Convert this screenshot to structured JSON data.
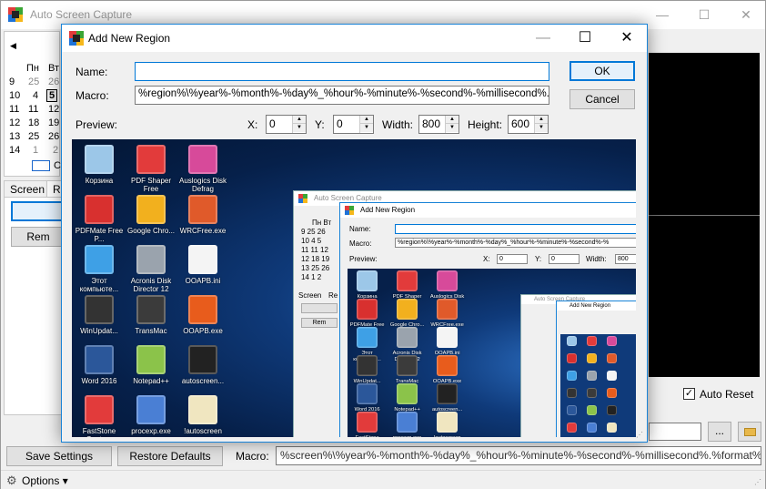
{
  "colors": {
    "accent": "#0078d7",
    "desktop": "#0f3a7a",
    "title_text_inactive": "#999999"
  },
  "main_window": {
    "title": "Auto Screen Capture",
    "icon": "auto-screen-capture-app-icon",
    "window_buttons": {
      "minimize": "—",
      "maximize": "☐",
      "close": "✕"
    },
    "calendar": {
      "nav_prev": "◀",
      "day_headers": [
        "Пн",
        "Вт"
      ],
      "weeks": [
        "9",
        "10",
        "11",
        "12",
        "13",
        "14"
      ],
      "col1": [
        "25",
        "4",
        "11",
        "18",
        "25",
        "1"
      ],
      "col2": [
        "26",
        "5",
        "12",
        "19",
        "26",
        "2"
      ],
      "selected": "5",
      "today_suffix": "C"
    },
    "tabs": [
      "Screen",
      "Re"
    ],
    "left_buttons": [
      "",
      "Rem"
    ],
    "auto_reset": {
      "label": "Auto Reset",
      "checked": true
    },
    "browse_button": "...",
    "save_settings": "Save Settings",
    "restore_defaults": "Restore Defaults",
    "macro_label": "Macro:",
    "macro_value": "%screen%\\%year%-%month%-%day%_%hour%-%minute%-%second%-%millisecond%.%format%",
    "status": {
      "options_label": "Options ▾"
    }
  },
  "dialog": {
    "title": "Add New Region",
    "window_buttons": {
      "minimize": "—",
      "maximize": "☐",
      "close": "✕"
    },
    "name_label": "Name:",
    "name_value": "",
    "macro_label": "Macro:",
    "macro_value": "%region%\\%year%-%month%-%day%_%hour%-%minute%-%second%-%millisecond%.%format%",
    "preview_label": "Preview:",
    "x_label": "X:",
    "x_value": "0",
    "y_label": "Y:",
    "y_value": "0",
    "width_label": "Width:",
    "width_value": "800",
    "height_label": "Height:",
    "height_value": "600",
    "ok_label": "OK",
    "cancel_label": "Cancel",
    "desktop_icons": [
      {
        "name": "recycle-bin-icon",
        "label": "Корзина",
        "color": "#9cc7e8"
      },
      {
        "name": "pdf-shaper-icon",
        "label": "PDF Shaper Free",
        "color": "#e23b3b"
      },
      {
        "name": "auslogics-icon",
        "label": "Auslogics Disk Defrag",
        "color": "#d74a9a"
      },
      {
        "name": "pdfmate-icon",
        "label": "PDFMate Free P...",
        "color": "#d8302f"
      },
      {
        "name": "google-chrome-icon",
        "label": "Google Chro...",
        "color": "#f2b01e"
      },
      {
        "name": "wrcfree-icon",
        "label": "WRCFree.exe",
        "color": "#e05a2a"
      },
      {
        "name": "this-pc-icon",
        "label": "Этот компьюте...",
        "color": "#3ea0e6"
      },
      {
        "name": "acronis-icon",
        "label": "Acronis Disk Director 12",
        "color": "#9aa3ad"
      },
      {
        "name": "ooapb-ini-icon",
        "label": "OOAPB.ini",
        "color": "#f4f4f4"
      },
      {
        "name": "winupdate-icon",
        "label": "WinUpdat...",
        "color": "#333333"
      },
      {
        "name": "transmac-icon",
        "label": "TransMac",
        "color": "#3b3b3b"
      },
      {
        "name": "ooapb-exe-icon",
        "label": "OOAPB.exe",
        "color": "#e85c1c"
      },
      {
        "name": "word-icon",
        "label": "Word 2016",
        "color": "#2b579a"
      },
      {
        "name": "notepad-icon",
        "label": "Notepad++",
        "color": "#8bc34a"
      },
      {
        "name": "autoscreen-icon",
        "label": "autoscreen...",
        "color": "#222222"
      },
      {
        "name": "faststone-icon",
        "label": "FastStone Capture",
        "color": "#e23b3b"
      },
      {
        "name": "procexp-icon",
        "label": "procexp.exe",
        "color": "#4a7fd4"
      },
      {
        "name": "autoscreen-exe-icon",
        "label": "!autoscreen",
        "color": "#f0e6c0"
      }
    ]
  },
  "nested": {
    "main_title": "Auto Screen Capture",
    "dialog_title": "Add New Region",
    "name_label": "Name:",
    "macro_label": "Macro:",
    "macro_value": "%region%\\%year%-%month%-%day%_%hour%-%minute%-%second%-%",
    "preview_label": "Preview:",
    "x_label": "X:",
    "x_value": "0",
    "y_label": "Y:",
    "y_value": "0",
    "width_label": "Width:",
    "width_value": "800",
    "cal_header": "Пн  Вт",
    "cal_rows": [
      "9  25  26",
      "10   4  5",
      "11  11  12",
      "12  18  19",
      "13  25  26",
      "14   1   2"
    ],
    "tab_screen": "Screen",
    "tab_re": "Re",
    "rem_button": "Rem",
    "tiny_title_1": "Auto Screen Capture",
    "tiny_title_2": "Add New Region"
  }
}
